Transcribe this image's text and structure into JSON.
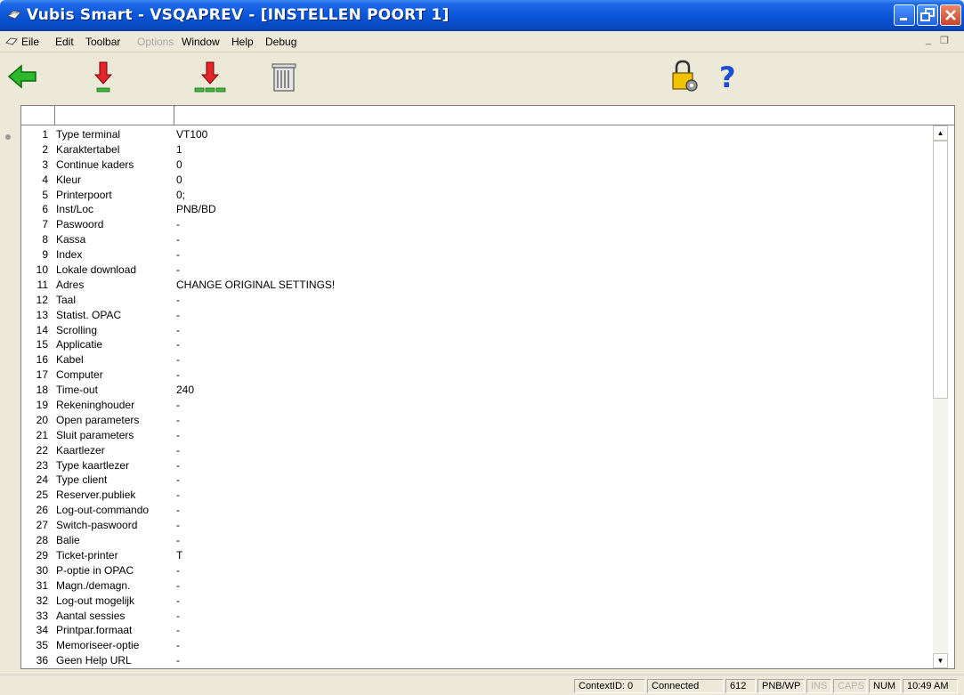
{
  "window": {
    "title": "Vubis Smart - VSQAPREV - [INSTELLEN POORT 1]"
  },
  "menu": {
    "items": [
      "Eile",
      "Edit",
      "Toolbar",
      "Options",
      "Window",
      "Help",
      "Debug"
    ],
    "disabled": [
      "Options"
    ]
  },
  "toolbar": {
    "buttons": [
      "back-arrow-icon",
      "download-icon",
      "download-all-icon",
      "trash-icon",
      "lock-settings-icon",
      "help-icon"
    ]
  },
  "grid": {
    "rows": [
      {
        "n": "1",
        "label": "Type terminal",
        "value": "VT100"
      },
      {
        "n": "2",
        "label": "Karaktertabel",
        "value": "1"
      },
      {
        "n": "3",
        "label": "Continue kaders",
        "value": "0"
      },
      {
        "n": "4",
        "label": "Kleur",
        "value": "0"
      },
      {
        "n": "5",
        "label": "Printerpoort",
        "value": "0;"
      },
      {
        "n": "6",
        "label": "Inst/Loc",
        "value": "PNB/BD"
      },
      {
        "n": "7",
        "label": "Paswoord",
        "value": "-"
      },
      {
        "n": "8",
        "label": "Kassa",
        "value": "-"
      },
      {
        "n": "9",
        "label": "Index",
        "value": "-"
      },
      {
        "n": "10",
        "label": "Lokale download",
        "value": "-"
      },
      {
        "n": "11",
        "label": "Adres",
        "value": "CHANGE ORIGINAL SETTINGS!"
      },
      {
        "n": "12",
        "label": "Taal",
        "value": "-"
      },
      {
        "n": "13",
        "label": "Statist. OPAC",
        "value": "-"
      },
      {
        "n": "14",
        "label": "Scrolling",
        "value": "-"
      },
      {
        "n": "15",
        "label": "Applicatie",
        "value": "-"
      },
      {
        "n": "16",
        "label": "Kabel",
        "value": "-"
      },
      {
        "n": "17",
        "label": "Computer",
        "value": "-"
      },
      {
        "n": "18",
        "label": "Time-out",
        "value": "240"
      },
      {
        "n": "19",
        "label": "Rekeninghouder",
        "value": "-"
      },
      {
        "n": "20",
        "label": "Open parameters",
        "value": "-"
      },
      {
        "n": "21",
        "label": "Sluit parameters",
        "value": "-"
      },
      {
        "n": "22",
        "label": "Kaartlezer",
        "value": "-"
      },
      {
        "n": "23",
        "label": "Type kaartlezer",
        "value": "-"
      },
      {
        "n": "24",
        "label": "Type client",
        "value": "-"
      },
      {
        "n": "25",
        "label": "Reserver.publiek",
        "value": "-"
      },
      {
        "n": "26",
        "label": "Log-out-commando",
        "value": "-"
      },
      {
        "n": "27",
        "label": "Switch-paswoord",
        "value": "-"
      },
      {
        "n": "28",
        "label": "Balie",
        "value": "-"
      },
      {
        "n": "29",
        "label": "Ticket-printer",
        "value": "T"
      },
      {
        "n": "30",
        "label": "P-optie in OPAC",
        "value": "-"
      },
      {
        "n": "31",
        "label": "Magn./demagn.",
        "value": "-"
      },
      {
        "n": "32",
        "label": "Log-out mogelijk",
        "value": "-"
      },
      {
        "n": "33",
        "label": "Aantal sessies",
        "value": "-"
      },
      {
        "n": "34",
        "label": "Printpar.formaat",
        "value": "-"
      },
      {
        "n": "35",
        "label": "Memoriseer-optie",
        "value": "-"
      },
      {
        "n": "36",
        "label": "Geen Help URL",
        "value": "-"
      }
    ]
  },
  "statusbar": {
    "context": "ContextID: 0",
    "connection": "Connected",
    "code": "612",
    "location": "PNB/WP",
    "ins": "INS",
    "caps": "CAPS",
    "num": "NUM",
    "time": "10:49 AM"
  }
}
